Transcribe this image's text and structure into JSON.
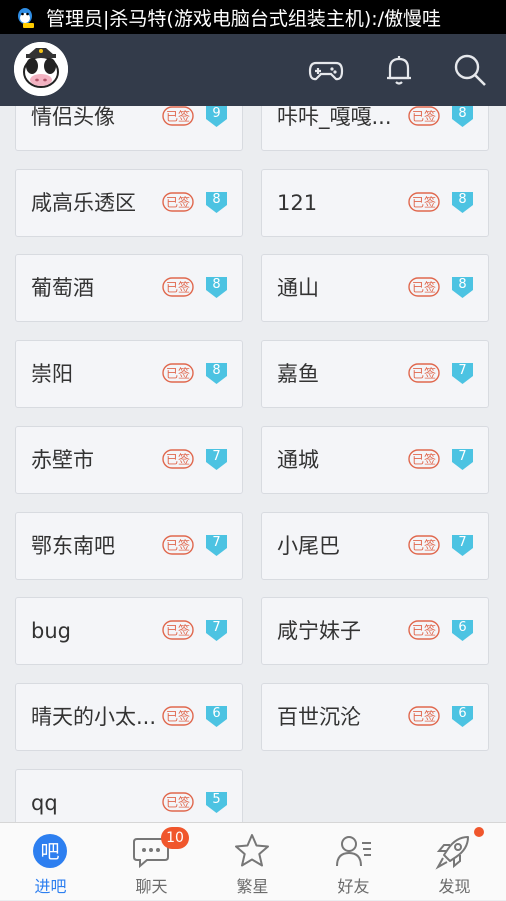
{
  "status_bar": {
    "notification_text": "管理员|杀马特(游戏电脑台式组装主机):/傲慢哇"
  },
  "colors": {
    "accent": "#2d7ff0",
    "header": "#333b4a",
    "signed": "#e0684e",
    "level": "#4cc3e2",
    "badge": "#f0562c"
  },
  "forums": [
    {
      "name": "情侣头像",
      "signed": "已签",
      "level": "9"
    },
    {
      "name": "咔咔_嘎嘎...",
      "signed": "已签",
      "level": "8"
    },
    {
      "name": "咸高乐透区",
      "signed": "已签",
      "level": "8"
    },
    {
      "name": "121",
      "signed": "已签",
      "level": "8"
    },
    {
      "name": "葡萄酒",
      "signed": "已签",
      "level": "8"
    },
    {
      "name": "通山",
      "signed": "已签",
      "level": "8"
    },
    {
      "name": "崇阳",
      "signed": "已签",
      "level": "8"
    },
    {
      "name": "嘉鱼",
      "signed": "已签",
      "level": "7"
    },
    {
      "name": "赤壁市",
      "signed": "已签",
      "level": "7"
    },
    {
      "name": "通城",
      "signed": "已签",
      "level": "7"
    },
    {
      "name": "鄂东南吧",
      "signed": "已签",
      "level": "7"
    },
    {
      "name": "小尾巴",
      "signed": "已签",
      "level": "7"
    },
    {
      "name": "bug",
      "signed": "已签",
      "level": "7"
    },
    {
      "name": "咸宁妹子",
      "signed": "已签",
      "level": "6"
    },
    {
      "name": "晴天的小太...",
      "signed": "已签",
      "level": "6"
    },
    {
      "name": "百世沉沦",
      "signed": "已签",
      "level": "6"
    },
    {
      "name": "qq",
      "signed": "已签",
      "level": "5"
    }
  ],
  "tabs": [
    {
      "label": "进吧",
      "icon_text": "吧"
    },
    {
      "label": "聊天",
      "badge": "10"
    },
    {
      "label": "繁星"
    },
    {
      "label": "好友"
    },
    {
      "label": "发现"
    }
  ]
}
